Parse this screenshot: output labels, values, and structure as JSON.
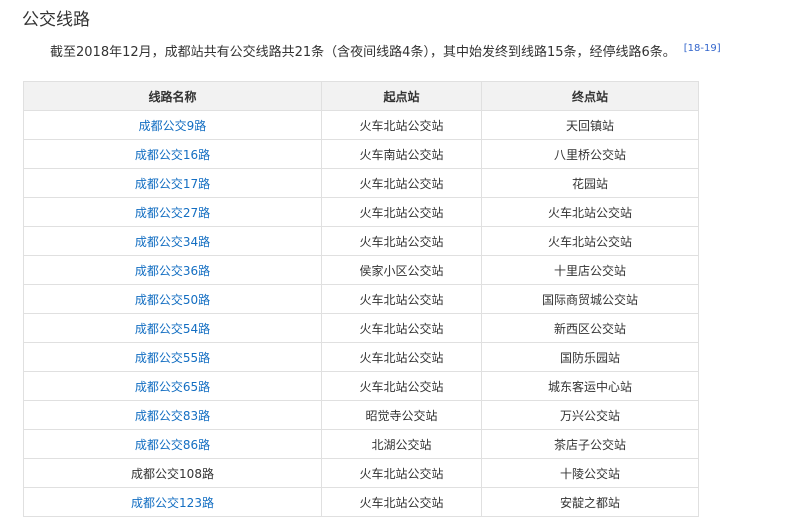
{
  "section": {
    "heading": "公交线路",
    "intro": "截至2018年12月，成都站共有公交线路共21条（含夜间线路4条），其中始发终到线路15条，经停线路6条。",
    "citation": "[18-19]"
  },
  "table": {
    "headers": [
      "线路名称",
      "起点站",
      "终点站"
    ],
    "rows": [
      {
        "name": "成都公交9路",
        "linked": true,
        "start": "火车北站公交站",
        "end": "天回镇站"
      },
      {
        "name": "成都公交16路",
        "linked": true,
        "start": "火车南站公交站",
        "end": "八里桥公交站"
      },
      {
        "name": "成都公交17路",
        "linked": true,
        "start": "火车北站公交站",
        "end": "花园站"
      },
      {
        "name": "成都公交27路",
        "linked": true,
        "start": "火车北站公交站",
        "end": "火车北站公交站"
      },
      {
        "name": "成都公交34路",
        "linked": true,
        "start": "火车北站公交站",
        "end": "火车北站公交站"
      },
      {
        "name": "成都公交36路",
        "linked": true,
        "start": "侯家小区公交站",
        "end": "十里店公交站"
      },
      {
        "name": "成都公交50路",
        "linked": true,
        "start": "火车北站公交站",
        "end": "国际商贸城公交站"
      },
      {
        "name": "成都公交54路",
        "linked": true,
        "start": "火车北站公交站",
        "end": "新西区公交站"
      },
      {
        "name": "成都公交55路",
        "linked": true,
        "start": "火车北站公交站",
        "end": "国防乐园站"
      },
      {
        "name": "成都公交65路",
        "linked": true,
        "start": "火车北站公交站",
        "end": "城东客运中心站"
      },
      {
        "name": "成都公交83路",
        "linked": true,
        "start": "昭觉寺公交站",
        "end": "万兴公交站"
      },
      {
        "name": "成都公交86路",
        "linked": true,
        "start": "北湖公交站",
        "end": "茶店子公交站"
      },
      {
        "name": "成都公交108路",
        "linked": false,
        "start": "火车北站公交站",
        "end": "十陵公交站"
      },
      {
        "name": "成都公交123路",
        "linked": true,
        "start": "火车北站公交站",
        "end": "安靛之都站"
      }
    ]
  }
}
